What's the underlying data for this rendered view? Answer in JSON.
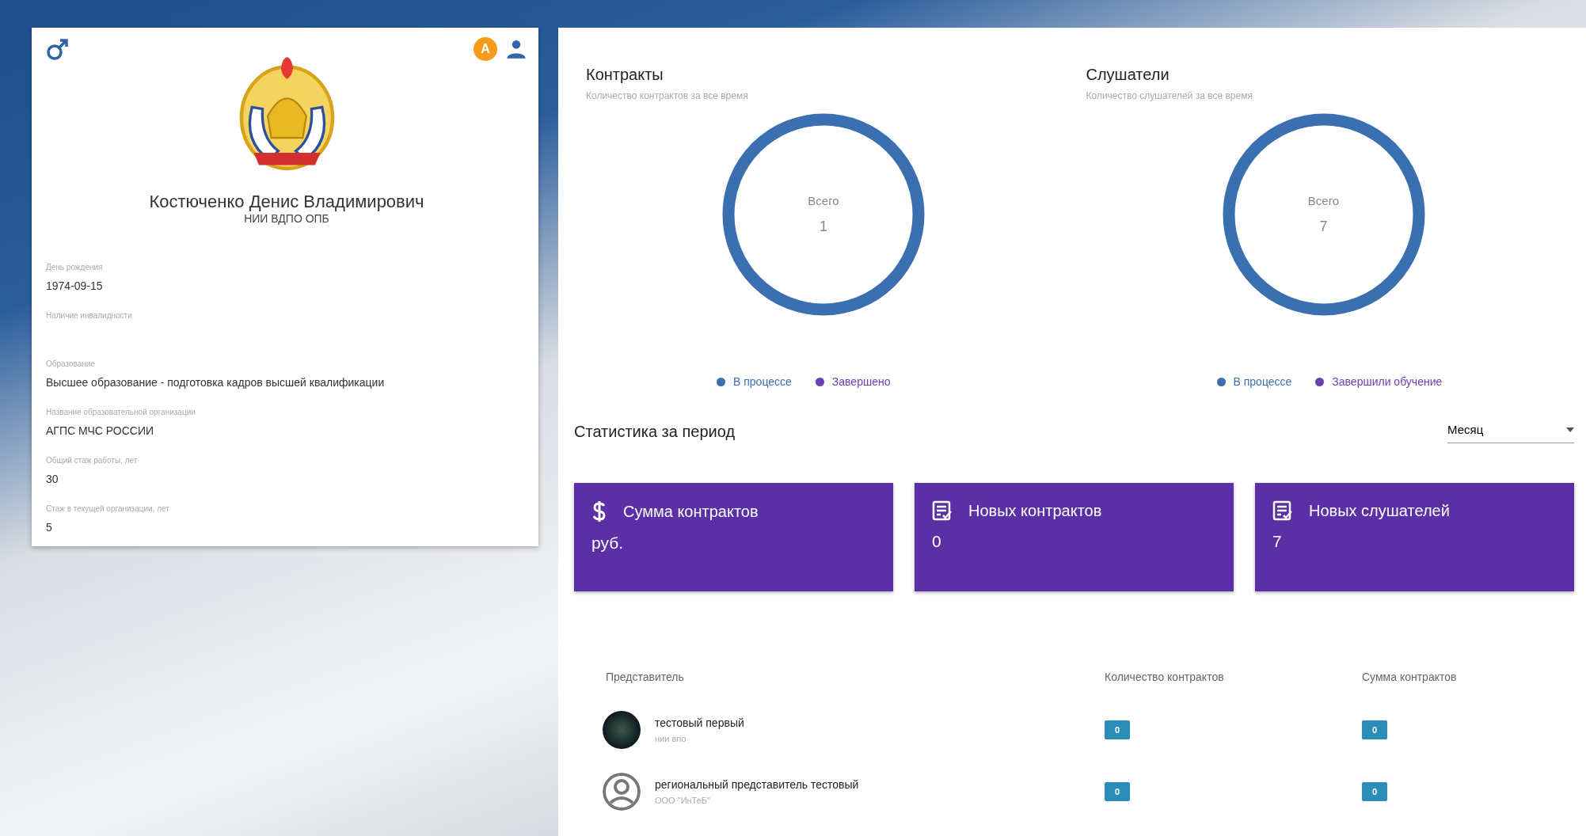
{
  "profile": {
    "name": "Костюченко Денис Владимирович",
    "organization": "НИИ ВДПО ОПБ",
    "badge": "A",
    "fields": [
      {
        "label": "День рождения",
        "value": "1974-09-15"
      },
      {
        "label": "Наличие инвалидности"
      },
      {
        "label": "Образование",
        "value": "Высшее образование - подготовка кадров высшей квалификации"
      },
      {
        "label": "Название образовательной организации",
        "value": "АГПС МЧС РОССИИ"
      },
      {
        "label": "Общий стаж работы, лет",
        "value": "30"
      },
      {
        "label": "Стаж в текущей организации, лет",
        "value": "5"
      }
    ]
  },
  "charts": [
    {
      "title": "Контракты",
      "subtitle": "Количество контрактов за все время",
      "center_label": "Всего",
      "center_value": "1",
      "legend": [
        {
          "label": "В процессе",
          "color": "#3a6fb0"
        },
        {
          "label": "Завершено",
          "color": "#6a3fb5"
        }
      ]
    },
    {
      "title": "Слушатели",
      "subtitle": "Количество слушателей за все время",
      "center_label": "Всего",
      "center_value": "7",
      "legend": [
        {
          "label": "В процессе",
          "color": "#3a6fb0"
        },
        {
          "label": "Завершили обучение",
          "color": "#6a3fb5"
        }
      ]
    }
  ],
  "stats": {
    "title": "Статистика за период",
    "period": "Месяц",
    "cards": [
      {
        "kind": "money",
        "title": "Сумма контрактов",
        "value": "руб."
      },
      {
        "kind": "list",
        "title": "Новых контрактов",
        "value": "0"
      },
      {
        "kind": "list",
        "title": "Новых слушателей",
        "value": "7"
      }
    ]
  },
  "table": {
    "columns": [
      "Представитель",
      "Количество контрактов",
      "Сумма контрактов"
    ],
    "rows": [
      {
        "kind": "photo",
        "name": "тестовый первый",
        "organization": "нии впо",
        "count": "0",
        "sum": "0"
      },
      {
        "kind": "default",
        "name": "региональный представитель тестовый",
        "organization": "ООО \"ИнТеБ\"",
        "count": "0",
        "sum": "0"
      }
    ]
  }
}
